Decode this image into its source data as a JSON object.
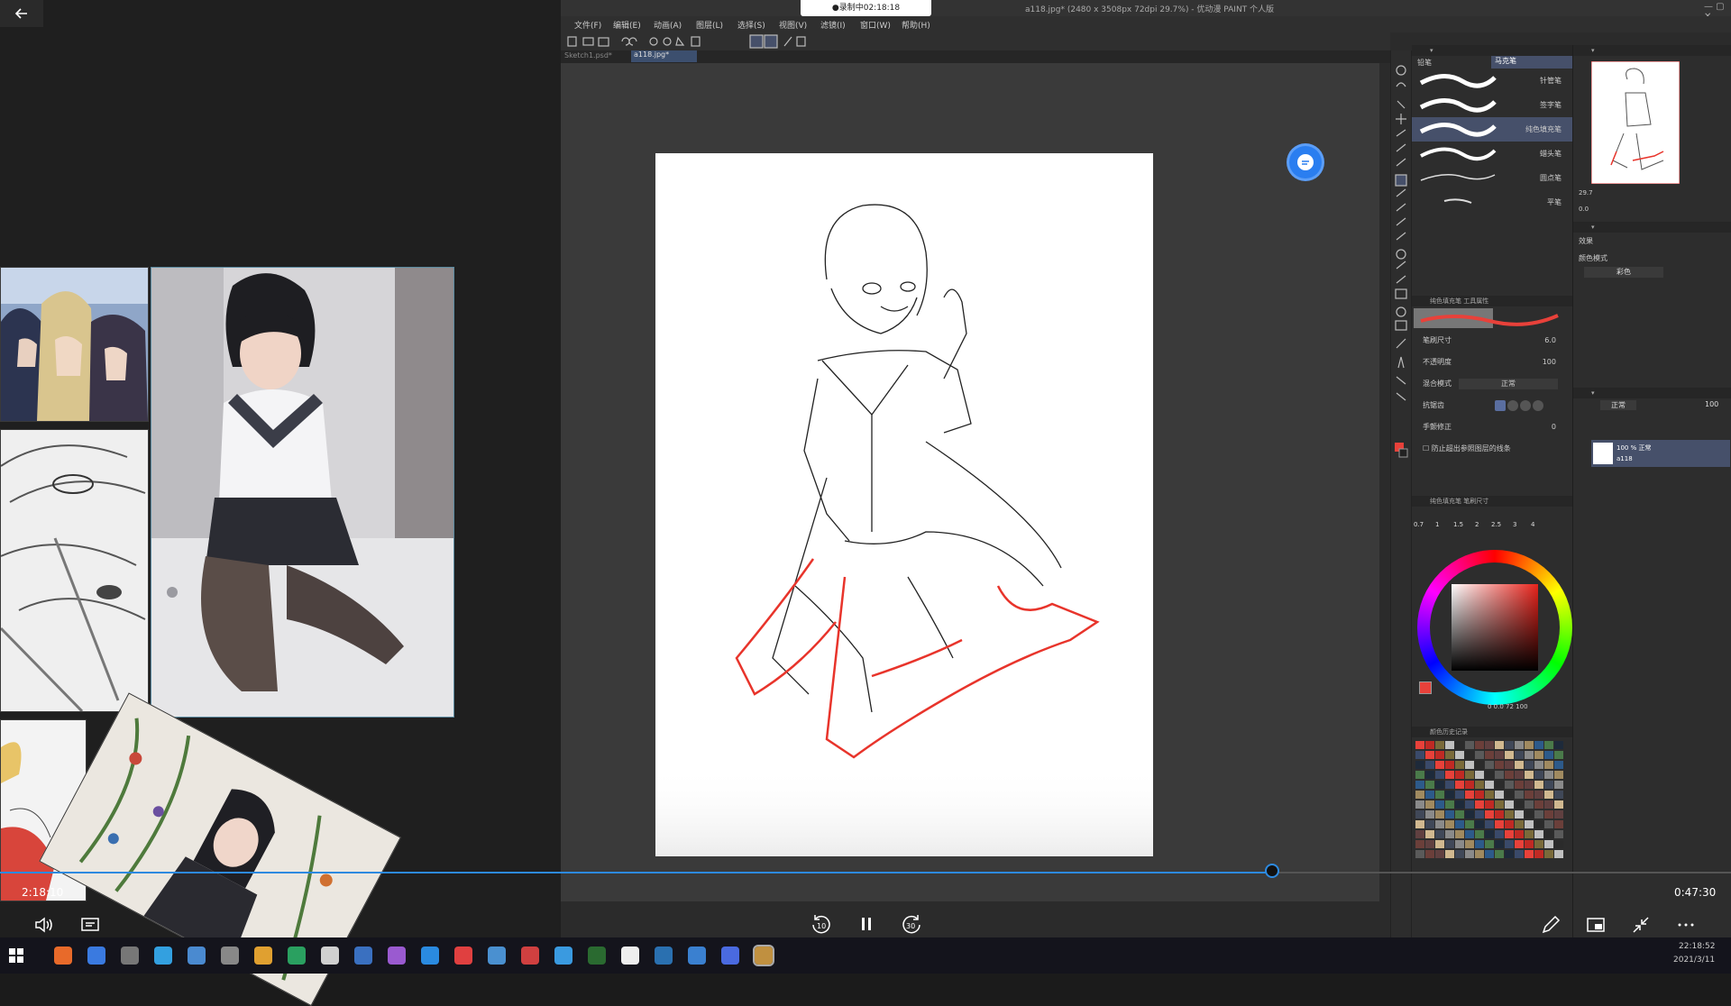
{
  "player": {
    "back_icon": "arrow-left-icon",
    "current_time": "2:18:10",
    "total_time": "0:47:30",
    "progress": 0.735,
    "controls": [
      "volume-icon",
      "subtitles-icon",
      "rewind-10-icon",
      "pause-icon",
      "forward-30-icon",
      "pen-icon",
      "picture-in-picture-icon",
      "collapse-icon",
      "more-icon"
    ],
    "rewind_label": "10",
    "forward_label": "30",
    "recording": "●录制中02:18:18"
  },
  "app": {
    "title": "a118.jpg* (2480 x 3508px 72dpi 29.7%) - 优动漫 PAINT 个人版",
    "menu": [
      "文件(F)",
      "编辑(E)",
      "动画(A)",
      "图层(L)",
      "选择(S)",
      "视图(V)",
      "滤镜(I)",
      "窗口(W)",
      "帮助(H)"
    ],
    "tabs": [
      "Sketch1.psd*",
      "a118.jpg*"
    ],
    "subtool_tabs": [
      "铅笔",
      "马克笔"
    ],
    "brushes": [
      "针管笔",
      "签字笔",
      "纯色填充笔",
      "蜡头笔",
      "圆点笔",
      "平笔"
    ],
    "tool_property_title": "纯色填充笔 工具属性",
    "properties": [
      {
        "label": "笔刷尺寸",
        "value": "6.0"
      },
      {
        "label": "不透明度",
        "value": "100"
      },
      {
        "label": "混合模式",
        "value": "正常"
      },
      {
        "label": "抗锯齿",
        "value": ""
      },
      {
        "label": "手颤修正",
        "value": "0"
      }
    ],
    "checkbox_label": "防止超出参照图层的线条",
    "brush_size_title": "纯色填充笔 笔刷尺寸",
    "brush_sizes": [
      "0.7",
      "1",
      "1.5",
      "2",
      "2.5",
      "3",
      "4"
    ],
    "color_history_title": "颜色历史记录",
    "color_mode_label": "颜色模式",
    "color_mode_value": "彩色",
    "effect_label": "效果",
    "layer_blend": "正常",
    "layer_opacity": "100",
    "layer_name": "100 % 正常",
    "layer_sub": "a118",
    "navigator_zoom": "29.7",
    "navigator_angle": "0.0",
    "color_values": "0  0.0  72  100",
    "primary_color": "#e8413a"
  },
  "taskbar": {
    "time": "22:18:52",
    "date": "2021/3/11"
  }
}
